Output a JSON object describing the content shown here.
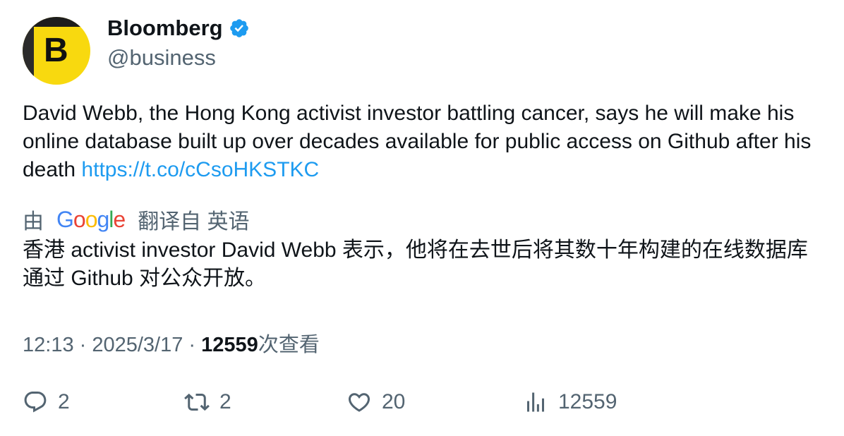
{
  "account": {
    "name": "Bloomberg",
    "handle": "@business",
    "avatar_letter": "B",
    "avatar_color": "#f8d90f",
    "verified_color": "#1d9bf0"
  },
  "tweet": {
    "text": "David Webb, the Hong Kong activist investor battling cancer, says he will make his online database built up over decades available for public access on Github after his death ",
    "link": "https://t.co/cCsoHKSTKC",
    "link_color": "#1d9bf0"
  },
  "translation": {
    "prefix": "由",
    "provider_letters": [
      "G",
      "o",
      "o",
      "g",
      "l",
      "e"
    ],
    "suffix": "翻译自 英语",
    "text": "香港 activist investor David Webb 表示，他将在去世后将其数十年构建的在线数据库通过 Github 对公众开放。"
  },
  "meta": {
    "time": "12:13",
    "separator": " · ",
    "date": "2025/3/17",
    "views_count": "12559",
    "views_label": "次查看"
  },
  "actions": {
    "replies": "2",
    "retweets": "2",
    "likes": "20",
    "views": "12559"
  },
  "icons": {
    "reply": "reply-bubble-icon",
    "retweet": "retweet-icon",
    "like": "heart-icon",
    "views": "bar-chart-icon",
    "verified": "verified-badge-icon"
  }
}
